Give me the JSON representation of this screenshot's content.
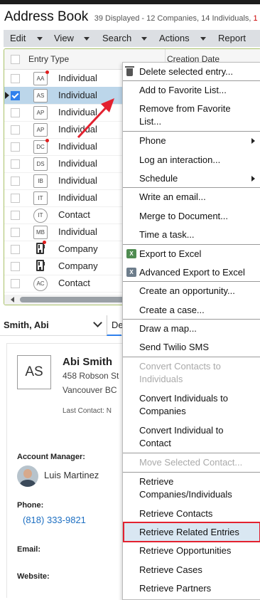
{
  "header": {
    "title": "Address Book",
    "subtitle": "39 Displayed - 12 Companies, 14 Individuals, ",
    "subtitle_highlight": "1"
  },
  "menubar": {
    "items": [
      {
        "label": "Edit"
      },
      {
        "label": "View"
      },
      {
        "label": "Search"
      },
      {
        "label": "Actions"
      },
      {
        "label": "Report"
      }
    ]
  },
  "grid": {
    "columns": [
      "Entry Type",
      "Creation Date"
    ],
    "rows": [
      {
        "badge": "AA",
        "type": "Individual",
        "dot": true
      },
      {
        "badge": "AS",
        "type": "Individual",
        "selected": true,
        "checked": true
      },
      {
        "badge": "AP",
        "type": "Individual"
      },
      {
        "badge": "AP",
        "type": "Individual"
      },
      {
        "badge": "DC",
        "type": "Individual",
        "dot": true
      },
      {
        "badge": "DS",
        "type": "Individual"
      },
      {
        "badge": "IB",
        "type": "Individual"
      },
      {
        "badge": "IT",
        "type": "Individual"
      },
      {
        "badge": "IT",
        "type": "Contact"
      },
      {
        "badge": "MB",
        "type": "Individual"
      },
      {
        "badge": "building",
        "type": "Company",
        "dot": true
      },
      {
        "badge": "building",
        "type": "Company"
      },
      {
        "badge": "AC",
        "type": "Contact"
      }
    ]
  },
  "contact": {
    "tab_name": "Smith, Abi",
    "details_tab_label": "De",
    "initials": "AS",
    "name": "Abi Smith",
    "address_line1": "458 Robson St",
    "address_line2": "Vancouver BC",
    "last_contact": "Last Contact:  N",
    "account_manager_label": "Account Manager:",
    "account_manager": "Luis Martinez",
    "phone_label": "Phone:",
    "phone": "(818) 333-9821",
    "email_label": "Email:",
    "website_label": "Website:"
  },
  "context_menu": {
    "items": [
      {
        "label": "Delete selected entry...",
        "icon": "trash-icon"
      },
      {
        "label": "Add to Favorite List..."
      },
      {
        "label": "Remove from Favorite List..."
      },
      {
        "label": "Phone",
        "submenu": true
      },
      {
        "label": "Log an interaction..."
      },
      {
        "label": "Schedule",
        "submenu": true
      },
      {
        "label": "Write an email..."
      },
      {
        "label": "Merge to Document..."
      },
      {
        "label": "Time a task..."
      },
      {
        "label": "Export to Excel",
        "icon": "excel-icon"
      },
      {
        "label": "Advanced Export to Excel",
        "icon": "excel-advanced-icon"
      },
      {
        "label": "Create an opportunity..."
      },
      {
        "label": "Create a case..."
      },
      {
        "label": "Draw a map..."
      },
      {
        "label": "Send Twilio SMS"
      },
      {
        "label": "Convert Contacts to Individuals",
        "disabled": true
      },
      {
        "label": "Convert Individuals to Companies"
      },
      {
        "label": "Convert Individual to Contact"
      },
      {
        "label": "Move Selected Contact...",
        "disabled": true
      },
      {
        "label": "Retrieve Companies/Individuals"
      },
      {
        "label": "Retrieve Contacts"
      },
      {
        "label": "Retrieve Related Entries",
        "highlighted": true
      },
      {
        "label": "Retrieve Opportunities"
      },
      {
        "label": "Retrieve Cases"
      },
      {
        "label": "Retrieve Partners"
      }
    ]
  },
  "colors": {
    "highlight_border": "#e3212f",
    "annotation_arrow": "#e3212f",
    "selected_row": "#bcd6ea",
    "link": "#1d6fc2"
  }
}
